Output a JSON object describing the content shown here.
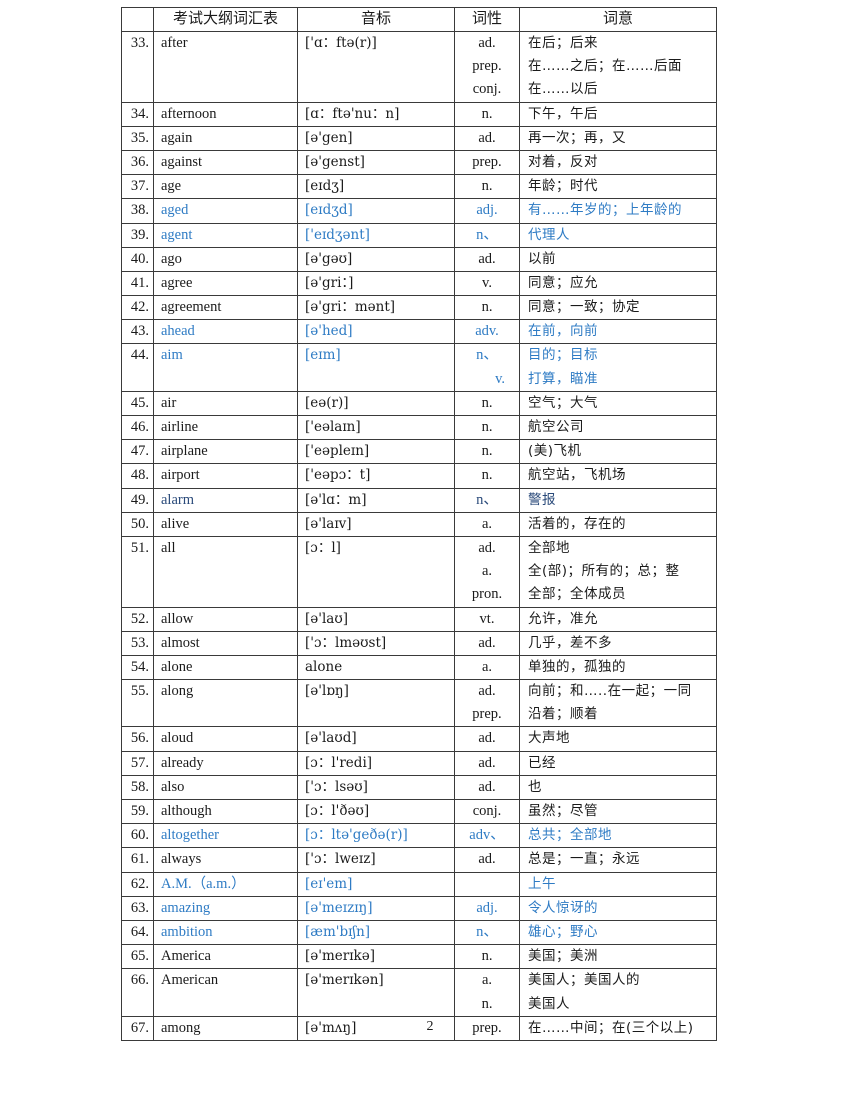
{
  "table": {
    "headers": [
      "",
      "考试大纲词汇表",
      "音标",
      "词性",
      "词意"
    ],
    "rows": [
      {
        "num": "33.",
        "word": "after",
        "ipa": "['ɑ：ftə(r)]",
        "pos": [
          "ad.",
          "prep.",
          "conj."
        ],
        "meaning": [
          "在后；后来",
          "在……之后；在……后面",
          "在……以后"
        ],
        "style": "normal"
      },
      {
        "num": "34.",
        "word": "afternoon",
        "ipa": "[ɑ：ftə'nu：n]",
        "pos": [
          "n."
        ],
        "meaning": [
          "下午，午后"
        ],
        "style": "normal"
      },
      {
        "num": "35.",
        "word": "again",
        "ipa": "[ə'gen]",
        "pos": [
          "ad."
        ],
        "meaning": [
          "再一次；再，又"
        ],
        "style": "normal"
      },
      {
        "num": "36.",
        "word": "against",
        "ipa": "[ə'genst]",
        "pos": [
          "prep."
        ],
        "meaning": [
          "对着，反对"
        ],
        "style": "normal"
      },
      {
        "num": "37.",
        "word": "age",
        "ipa": "[eɪdʒ]",
        "pos": [
          "n."
        ],
        "meaning": [
          "年龄；时代"
        ],
        "style": "normal"
      },
      {
        "num": "38.",
        "word": "aged",
        "ipa": "[eɪdʒd]",
        "pos": [
          "adj."
        ],
        "meaning": [
          "有……年岁的；上年龄的"
        ],
        "style": "blue"
      },
      {
        "num": "39.",
        "word": "agent",
        "ipa": "['eɪdʒənt]",
        "pos": [
          "n、"
        ],
        "meaning": [
          "代理人"
        ],
        "style": "blue"
      },
      {
        "num": "40.",
        "word": "ago",
        "ipa": "[ə'gəʊ]",
        "pos": [
          "ad."
        ],
        "meaning": [
          "以前"
        ],
        "style": "normal"
      },
      {
        "num": "41.",
        "word": "agree",
        "ipa": "[ə'gri：]",
        "pos": [
          "v."
        ],
        "meaning": [
          "同意；应允"
        ],
        "style": "normal"
      },
      {
        "num": "42.",
        "word": "agreement",
        "ipa": "[ə'gri：mənt]",
        "pos": [
          "n."
        ],
        "meaning": [
          "同意；一致；协定"
        ],
        "style": "normal"
      },
      {
        "num": "43.",
        "word": "ahead",
        "ipa": "[ə'hed]",
        "pos": [
          "adv."
        ],
        "meaning": [
          "在前，向前"
        ],
        "style": "blue"
      },
      {
        "num": "44.",
        "word": "aim",
        "ipa": "[eɪm]",
        "pos": [
          "n、",
          "v."
        ],
        "meaning": [
          "目的；目标",
          "打算，瞄准"
        ],
        "style": "blue"
      },
      {
        "num": "45.",
        "word": "air",
        "ipa": "[eə(r)]",
        "pos": [
          "n."
        ],
        "meaning": [
          "空气；大气"
        ],
        "style": "normal"
      },
      {
        "num": "46.",
        "word": "airline",
        "ipa": "['eəlaɪn]",
        "pos": [
          "n."
        ],
        "meaning": [
          "航空公司"
        ],
        "style": "normal"
      },
      {
        "num": "47.",
        "word": "airplane",
        "ipa": "['eəpleɪn]",
        "pos": [
          "n."
        ],
        "meaning": [
          "(美)飞机"
        ],
        "style": "normal"
      },
      {
        "num": "48.",
        "word": "airport",
        "ipa": "['eəpɔ：t]",
        "pos": [
          "n."
        ],
        "meaning": [
          "航空站，飞机场"
        ],
        "style": "normal"
      },
      {
        "num": "49.",
        "word": "alarm",
        "ipa": "[ə'lɑ：m]",
        "pos": [
          "n、"
        ],
        "meaning": [
          "警报"
        ],
        "style": "navy"
      },
      {
        "num": "50.",
        "word": "alive",
        "ipa": "[ə'laɪv]",
        "pos": [
          "a."
        ],
        "meaning": [
          "活着的，存在的"
        ],
        "style": "normal"
      },
      {
        "num": "51.",
        "word": "all",
        "ipa": "[ɔ：l]",
        "pos": [
          "ad.",
          "a.",
          "pron."
        ],
        "meaning": [
          "全部地",
          "全(部)；所有的；总；整",
          "全部；全体成员"
        ],
        "style": "normal"
      },
      {
        "num": "52.",
        "word": "allow",
        "ipa": "[ə'laʊ]",
        "pos": [
          "vt."
        ],
        "meaning": [
          "允许，准允"
        ],
        "style": "normal"
      },
      {
        "num": "53.",
        "word": "almost",
        "ipa": "['ɔ：lməʊst]",
        "pos": [
          "ad."
        ],
        "meaning": [
          "几乎，差不多"
        ],
        "style": "normal"
      },
      {
        "num": "54.",
        "word": "alone",
        "ipa": "alone",
        "pos": [
          "a."
        ],
        "meaning": [
          "单独的，孤独的"
        ],
        "style": "normal"
      },
      {
        "num": "55.",
        "word": "along",
        "ipa": "[ə'lɒŋ]",
        "pos": [
          "ad.",
          "prep."
        ],
        "meaning": [
          "向前；和…..在一起；一同",
          "沿着；顺着"
        ],
        "style": "normal"
      },
      {
        "num": "56.",
        "word": "aloud",
        "ipa": "[ə'laʊd]",
        "pos": [
          "ad."
        ],
        "meaning": [
          "大声地"
        ],
        "style": "normal"
      },
      {
        "num": "57.",
        "word": "already",
        "ipa": "[ɔ：l'redi]",
        "pos": [
          "ad."
        ],
        "meaning": [
          "已经"
        ],
        "style": "normal"
      },
      {
        "num": "58.",
        "word": "also",
        "ipa": "['ɔ：lsəʊ]",
        "pos": [
          "ad."
        ],
        "meaning": [
          "也"
        ],
        "style": "normal"
      },
      {
        "num": "59.",
        "word": "although",
        "ipa": "[ɔ：l'ðəʊ]",
        "pos": [
          "conj."
        ],
        "meaning": [
          "虽然；尽管"
        ],
        "style": "normal"
      },
      {
        "num": "60.",
        "word": "altogether",
        "ipa": "[ɔ：ltə'geðə(r)]",
        "pos": [
          "adv、"
        ],
        "meaning": [
          "总共；全部地"
        ],
        "style": "blue"
      },
      {
        "num": "61.",
        "word": "always",
        "ipa": "['ɔ：lweɪz]",
        "pos": [
          "ad."
        ],
        "meaning": [
          "总是；一直；永远"
        ],
        "style": "normal"
      },
      {
        "num": "62.",
        "word": "A.M.（a.m.）",
        "ipa": "[eɪ'em]",
        "pos": [
          ""
        ],
        "meaning": [
          "上午"
        ],
        "style": "blue"
      },
      {
        "num": "63.",
        "word": "amazing",
        "ipa": "[ə'meɪzɪŋ]",
        "pos": [
          "adj."
        ],
        "meaning": [
          "令人惊讶的"
        ],
        "style": "blue"
      },
      {
        "num": "64.",
        "word": "ambition",
        "ipa": "[æm'bɪʃn]",
        "pos": [
          "n、"
        ],
        "meaning": [
          "雄心；野心"
        ],
        "style": "blue"
      },
      {
        "num": "65.",
        "word": "America",
        "ipa": "[ə'merɪkə]",
        "pos": [
          "n."
        ],
        "meaning": [
          "美国；美洲"
        ],
        "style": "normal"
      },
      {
        "num": "66.",
        "word": "American",
        "ipa": "[ə'merɪkən]",
        "pos": [
          "a.",
          "n."
        ],
        "meaning": [
          "美国人；美国人的",
          "美国人"
        ],
        "style": "normal"
      },
      {
        "num": "67.",
        "word": "among",
        "ipa": "[ə'mʌŋ]",
        "pos": [
          "prep."
        ],
        "meaning": [
          "在……中间；在(三个以上)"
        ],
        "style": "normal"
      }
    ]
  },
  "footer": {
    "page_number": "2"
  },
  "colors": {
    "text": "#1a1a1a",
    "highlight_blue": "#2e7bc4",
    "highlight_navy": "#2a4a7a",
    "border": "#3a3a3a"
  }
}
